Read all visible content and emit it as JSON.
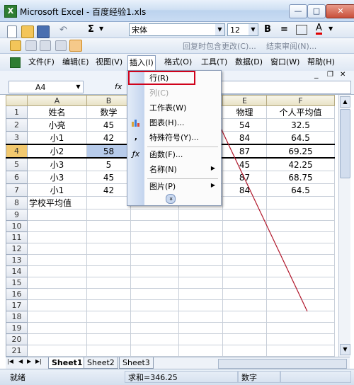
{
  "window": {
    "title": "Microsoft Excel - 百度经验1.xls",
    "app_icon_letter": "X",
    "min_glyph": "—",
    "max_glyph": "□",
    "close_glyph": "✕"
  },
  "formatting_toolbar": {
    "font_name": "宋体",
    "font_size": "12",
    "bold_label": "B",
    "font_color_label": "A",
    "sum_label": "Σ"
  },
  "review_toolbar": {
    "reply_label": "回复时包含更改(C)...",
    "end_review_label": "结束审阅(N)..."
  },
  "menu": {
    "items": [
      "文件(F)",
      "编辑(E)",
      "视图(V)",
      "插入(I)",
      "格式(O)",
      "工具(T)",
      "数据(D)",
      "窗口(W)",
      "帮助(H)"
    ],
    "doc_controls": [
      "_",
      "❐",
      "✕"
    ]
  },
  "formula_bar": {
    "name_box": "A4",
    "fx_label": "fx",
    "formula": ""
  },
  "sheet": {
    "columns": [
      "A",
      "B",
      "C",
      "D",
      "E",
      "F"
    ],
    "rows": [
      [
        "1",
        "姓名",
        "数学",
        "",
        "",
        "物理",
        "个人平均值"
      ],
      [
        "2",
        "小亮",
        "45",
        "",
        "",
        "54",
        "32.5"
      ],
      [
        "3",
        "小1",
        "42",
        "",
        "",
        "84",
        "64.5"
      ],
      [
        "4",
        "小2",
        "58",
        "",
        "",
        "87",
        "69.25"
      ],
      [
        "5",
        "小3",
        "5",
        "",
        "",
        "45",
        "42.25"
      ],
      [
        "6",
        "小3",
        "45",
        "",
        "",
        "87",
        "68.75"
      ],
      [
        "7",
        "小1",
        "42",
        "",
        "",
        "84",
        "64.5"
      ],
      [
        "8",
        "学校平均值",
        "",
        "",
        "",
        "",
        ""
      ],
      [
        "9",
        "",
        "",
        "",
        "",
        "",
        ""
      ],
      [
        "10",
        "",
        "",
        "",
        "",
        "",
        ""
      ],
      [
        "11",
        "",
        "",
        "",
        "",
        "",
        ""
      ],
      [
        "12",
        "",
        "",
        "",
        "",
        "",
        ""
      ],
      [
        "13",
        "",
        "",
        "",
        "",
        "",
        ""
      ],
      [
        "14",
        "",
        "",
        "",
        "",
        "",
        ""
      ],
      [
        "15",
        "",
        "",
        "",
        "",
        "",
        ""
      ],
      [
        "16",
        "",
        "",
        "",
        "",
        "",
        ""
      ],
      [
        "17",
        "",
        "",
        "",
        "",
        "",
        ""
      ],
      [
        "18",
        "",
        "",
        "",
        "",
        "",
        ""
      ],
      [
        "19",
        "",
        "",
        "",
        "",
        "",
        ""
      ],
      [
        "20",
        "",
        "",
        "",
        "",
        "",
        ""
      ],
      [
        "21",
        "",
        "",
        "",
        "",
        "",
        ""
      ]
    ],
    "selected_row": "4"
  },
  "insert_menu": {
    "items": [
      {
        "label": "行(R)",
        "icon": "",
        "submenu": false
      },
      {
        "label": "列(C)",
        "icon": "",
        "submenu": false
      },
      {
        "label": "工作表(W)",
        "icon": "",
        "submenu": false
      },
      {
        "label": "图表(H)...",
        "icon": "chart-icon",
        "submenu": false
      },
      {
        "label": "特殊符号(Y)...",
        "icon": "symbol-icon",
        "submenu": false
      },
      {
        "label": "函数(F)...",
        "icon": "function-icon",
        "submenu": false
      },
      {
        "label": "名称(N)",
        "icon": "",
        "submenu": true
      },
      {
        "label": "图片(P)",
        "icon": "",
        "submenu": true
      }
    ],
    "expand_glyph": "»"
  },
  "sheet_tabs": [
    "Sheet1",
    "Sheet2",
    "Sheet3"
  ],
  "status_bar": {
    "ready": "就绪",
    "sum": "求和=346.25",
    "mode": "数字"
  },
  "colors": {
    "highlight": "#d0021b",
    "arrow": "#b0162a"
  }
}
